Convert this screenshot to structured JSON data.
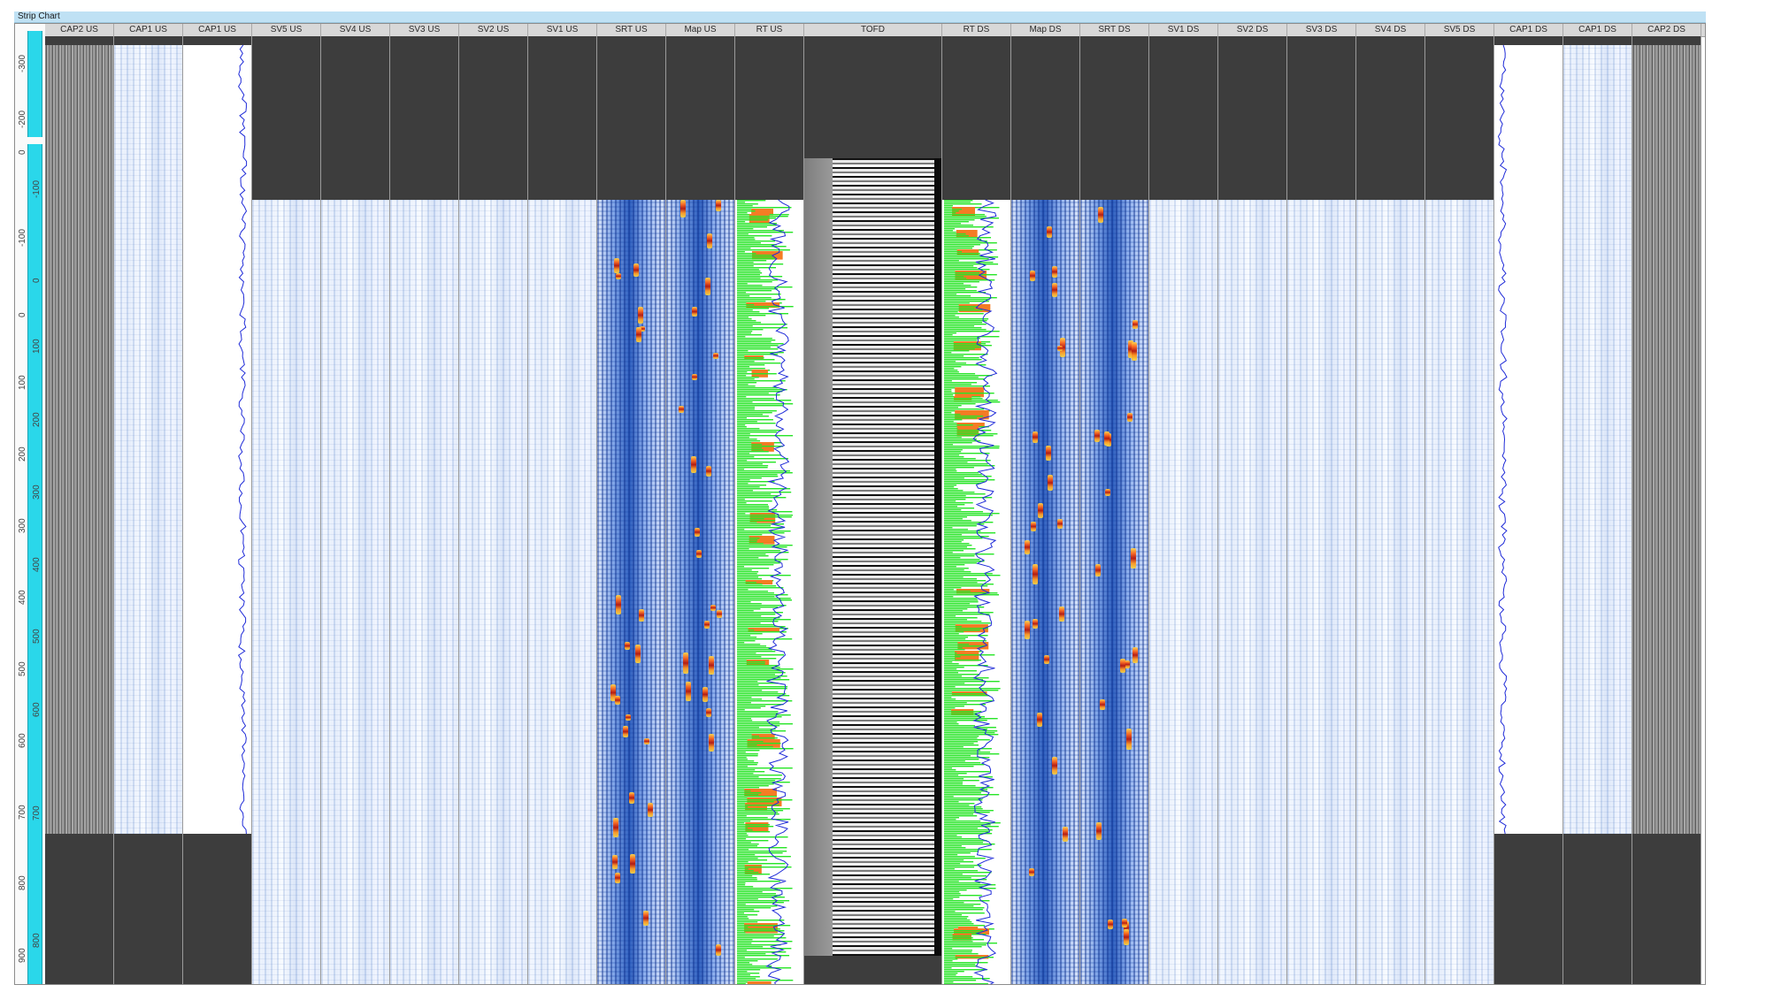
{
  "window": {
    "title": "Strip Chart"
  },
  "colors": {
    "ruler_bar": "#2ad7ea",
    "lane_empty": "#3d3d3d",
    "scan_blue": "#2f5fbe",
    "trace_green": "#27e527",
    "trace_orange": "#f47c24",
    "trace_line": "#1f2bd8"
  },
  "rulers": {
    "upper_ticks": [
      "-300",
      "-200",
      "0"
    ],
    "lower_ticks": [
      "-100",
      "0",
      "100",
      "200",
      "300",
      "400",
      "500",
      "600",
      "700",
      "800",
      "900"
    ],
    "inner_ticks": [
      "-100",
      "0",
      "100",
      "200",
      "300",
      "400",
      "500",
      "600",
      "700",
      "800"
    ]
  },
  "lanes": [
    {
      "label": "CAP2 US"
    },
    {
      "label": "CAP1 US"
    },
    {
      "label": "CAP1 US"
    },
    {
      "label": "SV5 US"
    },
    {
      "label": "SV4 US"
    },
    {
      "label": "SV3 US"
    },
    {
      "label": "SV2 US"
    },
    {
      "label": "SV1 US"
    },
    {
      "label": "SRT US"
    },
    {
      "label": "Map US"
    },
    {
      "label": "RT US"
    },
    {
      "label": "TOFD"
    },
    {
      "label": "RT DS"
    },
    {
      "label": "Map DS"
    },
    {
      "label": "SRT DS"
    },
    {
      "label": "SV1 DS"
    },
    {
      "label": "SV2 DS"
    },
    {
      "label": "SV3 DS"
    },
    {
      "label": "SV4 DS"
    },
    {
      "label": "SV5 DS"
    },
    {
      "label": "CAP1 DS"
    },
    {
      "label": "CAP1 DS"
    },
    {
      "label": "CAP2 DS"
    }
  ]
}
